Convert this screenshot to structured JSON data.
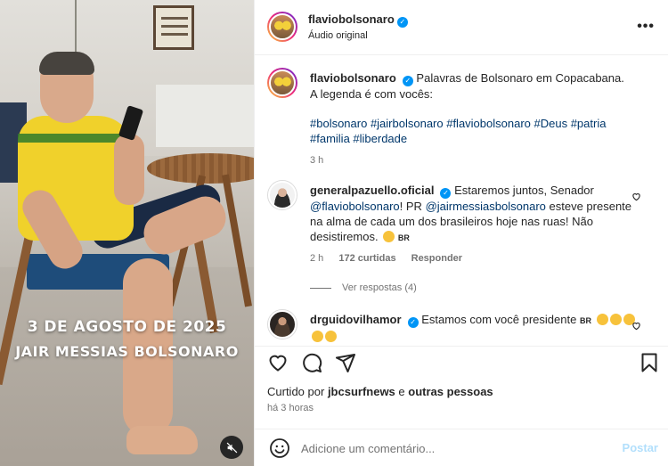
{
  "media": {
    "overlay_line1": "3 DE AGOSTO DE 2025",
    "overlay_line2": "JAIR MESSIAS BOLSONARO",
    "mute_icon": "speaker-muted-icon"
  },
  "header": {
    "username": "flaviobolsonaro",
    "subtitle": "Áudio original",
    "more_icon": "more-options-icon",
    "more_label": "•••"
  },
  "caption": {
    "username": "flaviobolsonaro",
    "text": "Palavras de Bolsonaro em Copacabana. A legenda é com vocês:",
    "hashtags_line1": "#bolsonaro #jairbolsonaro #flaviobolsonaro #Deus #patria",
    "hashtags_line2": "#familia #liberdade",
    "time": "3 h"
  },
  "comments": [
    {
      "username": "generalpazuello.oficial",
      "text_before_tag1": "Estaremos juntos, Senador",
      "tag1": "@flaviobolsonaro",
      "text_mid": "! PR",
      "tag2": "@jairmessiasbolsonaro",
      "text_after": "esteve presente na alma de cada um dos brasileiros hoje nas ruas! Não desistiremos.",
      "flag": "BR",
      "time": "2 h",
      "likes": "172 curtidas",
      "reply_label": "Responder",
      "view_replies": "Ver respostas (4)"
    },
    {
      "username": "drguidovilhamor",
      "text": "Estamos com você presidente",
      "flag": "BR"
    }
  ],
  "actions": {
    "like_icon": "heart-icon",
    "comment_icon": "comment-icon",
    "share_icon": "share-icon",
    "save_icon": "bookmark-icon"
  },
  "likes": {
    "prefix": "Curtido por",
    "user": "jbcsurfnews",
    "connector": "e",
    "others": "outras pessoas"
  },
  "timestamp": "há 3 horas",
  "composer": {
    "placeholder": "Adicione um comentário...",
    "post_label": "Postar",
    "emoji_icon": "emoji-icon"
  },
  "colors": {
    "verified": "#0095f6",
    "link": "#00376b",
    "post_disabled": "#b2dffc",
    "muted_text": "#737373"
  }
}
